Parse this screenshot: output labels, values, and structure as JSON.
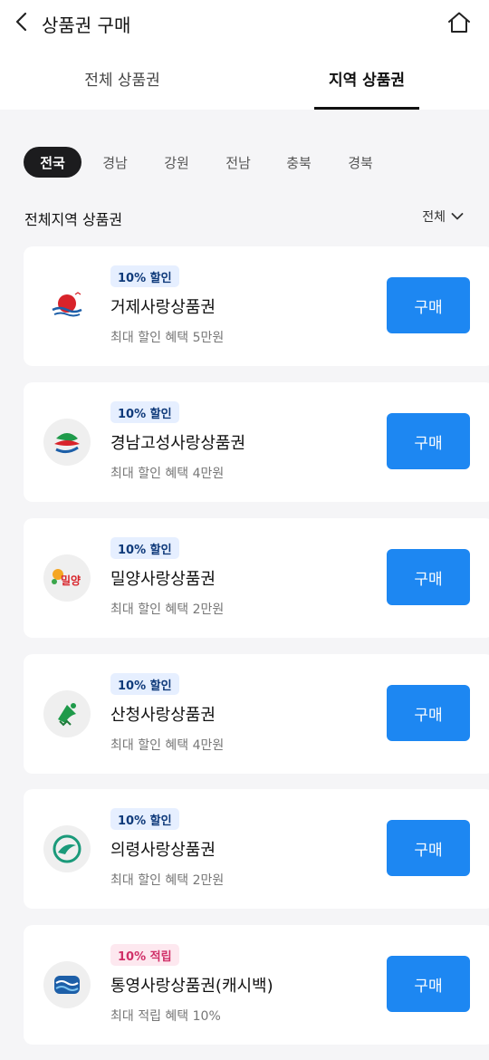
{
  "header": {
    "title": "상품권 구매",
    "back_icon": "chevron-left-icon",
    "home_icon": "home-icon"
  },
  "tabs": [
    {
      "label": "전체 상품권",
      "active": false
    },
    {
      "label": "지역 상품권",
      "active": true
    }
  ],
  "regions": [
    {
      "label": "전국",
      "active": true
    },
    {
      "label": "경남",
      "active": false
    },
    {
      "label": "강원",
      "active": false
    },
    {
      "label": "전남",
      "active": false
    },
    {
      "label": "충북",
      "active": false
    },
    {
      "label": "경북",
      "active": false
    }
  ],
  "section": {
    "title": "전체지역 상품권",
    "sort_label": "전체"
  },
  "vouchers": [
    {
      "badge": "10% 할인",
      "badge_type": "discount",
      "name": "거제사랑상품권",
      "benefit": "최대 할인 혜택 5만원",
      "button": "구매",
      "logo": "geoje-logo"
    },
    {
      "badge": "10% 할인",
      "badge_type": "discount",
      "name": "경남고성사랑상품권",
      "benefit": "최대 할인 혜택 4만원",
      "button": "구매",
      "logo": "goseong-logo"
    },
    {
      "badge": "10% 할인",
      "badge_type": "discount",
      "name": "밀양사랑상품권",
      "benefit": "최대 할인 혜택 2만원",
      "button": "구매",
      "logo": "miryang-logo",
      "logo_text": "밀양"
    },
    {
      "badge": "10% 할인",
      "badge_type": "discount",
      "name": "산청사랑상품권",
      "benefit": "최대 할인 혜택 4만원",
      "button": "구매",
      "logo": "sancheong-logo"
    },
    {
      "badge": "10% 할인",
      "badge_type": "discount",
      "name": "의령사랑상품권",
      "benefit": "최대 할인 혜택 2만원",
      "button": "구매",
      "logo": "uiryeong-logo"
    },
    {
      "badge": "10% 적립",
      "badge_type": "reward",
      "name": "통영사랑상품권(캐시백)",
      "benefit": "최대 적립 혜택 10%",
      "button": "구매",
      "logo": "tongyeong-logo"
    }
  ],
  "colors": {
    "accent": "#1d87f2",
    "discount_badge_bg": "#e6efff",
    "discount_badge_text": "#0f3a7a",
    "reward_badge_bg": "#fde8ef",
    "reward_badge_text": "#d03068",
    "chip_active": "#1c1c1e"
  }
}
